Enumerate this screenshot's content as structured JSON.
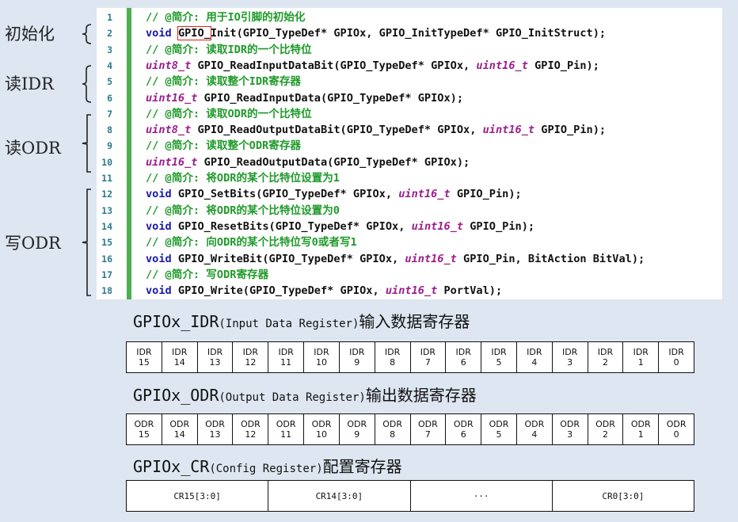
{
  "groups": [
    {
      "label": "初始化"
    },
    {
      "label": "读IDR"
    },
    {
      "label": "读ODR"
    },
    {
      "label": "写ODR"
    }
  ],
  "code": {
    "line_numbers": [
      "1",
      "2",
      "3",
      "4",
      "5",
      "6",
      "7",
      "8",
      "9",
      "10",
      "11",
      "12",
      "13",
      "14",
      "15",
      "16",
      "17",
      "18"
    ],
    "lines": [
      {
        "segments": [
          {
            "c": "cmt",
            "t": "// @简介: 用于IO引脚的初始化"
          }
        ]
      },
      {
        "segments": [
          {
            "c": "kw",
            "t": "void"
          },
          {
            "c": "fn",
            "t": " "
          },
          {
            "c": "fn hl",
            "t": "GPIO_"
          },
          {
            "c": "fn",
            "t": "Init(GPIO_TypeDef* GPIOx, GPIO_InitTypeDef* GPIO_InitStruct);"
          }
        ]
      },
      {
        "segments": [
          {
            "c": "cmt",
            "t": "// @简介: 读取IDR的一个比特位"
          }
        ]
      },
      {
        "segments": [
          {
            "c": "ty",
            "t": "uint8_t"
          },
          {
            "c": "fn",
            "t": " GPIO_ReadInputDataBit(GPIO_TypeDef* GPIOx, "
          },
          {
            "c": "ty",
            "t": "uint16_t"
          },
          {
            "c": "fn",
            "t": " GPIO_Pin);"
          }
        ]
      },
      {
        "segments": [
          {
            "c": "cmt",
            "t": "// @简介: 读取整个IDR寄存器"
          }
        ]
      },
      {
        "segments": [
          {
            "c": "ty",
            "t": "uint16_t"
          },
          {
            "c": "fn",
            "t": " GPIO_ReadInputData(GPIO_TypeDef* GPIOx);"
          }
        ]
      },
      {
        "segments": [
          {
            "c": "cmt",
            "t": "// @简介: 读取ODR的一个比特位"
          }
        ]
      },
      {
        "segments": [
          {
            "c": "ty",
            "t": "uint8_t"
          },
          {
            "c": "fn",
            "t": " GPIO_ReadOutputDataBit(GPIO_TypeDef* GPIOx, "
          },
          {
            "c": "ty",
            "t": "uint16_t"
          },
          {
            "c": "fn",
            "t": " GPIO_Pin);"
          }
        ]
      },
      {
        "segments": [
          {
            "c": "cmt",
            "t": "// @简介: 读取整个ODR寄存器"
          }
        ]
      },
      {
        "segments": [
          {
            "c": "ty",
            "t": "uint16_t"
          },
          {
            "c": "fn",
            "t": " GPIO_ReadOutputData(GPIO_TypeDef* GPIOx);"
          }
        ]
      },
      {
        "segments": [
          {
            "c": "cmt",
            "t": "// @简介: 将ODR的某个比特位设置为1"
          }
        ]
      },
      {
        "segments": [
          {
            "c": "kw",
            "t": "void"
          },
          {
            "c": "fn",
            "t": " GPIO_SetBits(GPIO_TypeDef* GPIOx, "
          },
          {
            "c": "ty",
            "t": "uint16_t"
          },
          {
            "c": "fn",
            "t": " GPIO_Pin);"
          }
        ]
      },
      {
        "segments": [
          {
            "c": "cmt",
            "t": "// @简介: 将ODR的某个比特位设置为0"
          }
        ]
      },
      {
        "segments": [
          {
            "c": "kw",
            "t": "void"
          },
          {
            "c": "fn",
            "t": " GPIO_ResetBits(GPIO_TypeDef* GPIOx, "
          },
          {
            "c": "ty",
            "t": "uint16_t"
          },
          {
            "c": "fn",
            "t": " GPIO_Pin);"
          }
        ]
      },
      {
        "segments": [
          {
            "c": "cmt",
            "t": "// @简介: 向ODR的某个比特位写0或者写1"
          }
        ]
      },
      {
        "segments": [
          {
            "c": "kw",
            "t": "void"
          },
          {
            "c": "fn",
            "t": " GPIO_WriteBit(GPIO_TypeDef* GPIOx, "
          },
          {
            "c": "ty",
            "t": "uint16_t"
          },
          {
            "c": "fn",
            "t": " GPIO_Pin, BitAction BitVal);"
          }
        ]
      },
      {
        "segments": [
          {
            "c": "cmt",
            "t": "// @简介: 写ODR寄存器"
          }
        ]
      },
      {
        "segments": [
          {
            "c": "kw",
            "t": "void"
          },
          {
            "c": "fn",
            "t": " GPIO_Write(GPIO_TypeDef* GPIOx, "
          },
          {
            "c": "ty",
            "t": "uint16_t"
          },
          {
            "c": "fn",
            "t": " PortVal);"
          }
        ]
      }
    ]
  },
  "registers": {
    "idr": {
      "name": "GPIOx_IDR",
      "desc": "(Input Data Register)",
      "cn": "输入数据寄存器",
      "bits": [
        {
          "name": "IDR",
          "num": "15"
        },
        {
          "name": "IDR",
          "num": "14"
        },
        {
          "name": "IDR",
          "num": "13"
        },
        {
          "name": "IDR",
          "num": "12"
        },
        {
          "name": "IDR",
          "num": "11"
        },
        {
          "name": "IDR",
          "num": "10"
        },
        {
          "name": "IDR",
          "num": "9"
        },
        {
          "name": "IDR",
          "num": "8"
        },
        {
          "name": "IDR",
          "num": "7"
        },
        {
          "name": "IDR",
          "num": "6"
        },
        {
          "name": "IDR",
          "num": "5"
        },
        {
          "name": "IDR",
          "num": "4"
        },
        {
          "name": "IDR",
          "num": "3"
        },
        {
          "name": "IDR",
          "num": "2"
        },
        {
          "name": "IDR",
          "num": "1"
        },
        {
          "name": "IDR",
          "num": "0"
        }
      ]
    },
    "odr": {
      "name": "GPIOx_ODR",
      "desc": "(Output Data Register)",
      "cn": "输出数据寄存器",
      "bits": [
        {
          "name": "ODR",
          "num": "15"
        },
        {
          "name": "ODR",
          "num": "14"
        },
        {
          "name": "ODR",
          "num": "13"
        },
        {
          "name": "ODR",
          "num": "12"
        },
        {
          "name": "ODR",
          "num": "11"
        },
        {
          "name": "ODR",
          "num": "10"
        },
        {
          "name": "ODR",
          "num": "9"
        },
        {
          "name": "ODR",
          "num": "8"
        },
        {
          "name": "ODR",
          "num": "7"
        },
        {
          "name": "ODR",
          "num": "6"
        },
        {
          "name": "ODR",
          "num": "5"
        },
        {
          "name": "ODR",
          "num": "4"
        },
        {
          "name": "ODR",
          "num": "3"
        },
        {
          "name": "ODR",
          "num": "2"
        },
        {
          "name": "ODR",
          "num": "1"
        },
        {
          "name": "ODR",
          "num": "0"
        }
      ]
    },
    "cr": {
      "name": "GPIOx_CR",
      "desc": "(Config Register)",
      "cn": "配置寄存器",
      "cells": [
        "CR15[3:0]",
        "CR14[3:0]",
        "···",
        "CR0[3:0]"
      ]
    }
  },
  "colors": {
    "background": "#dde6f1",
    "comment": "#1f9a2a",
    "keyword": "#1a1aa6",
    "type": "#9b1f8c",
    "gutter_bar": "#4caf50",
    "highlight_box": "#e02020"
  }
}
